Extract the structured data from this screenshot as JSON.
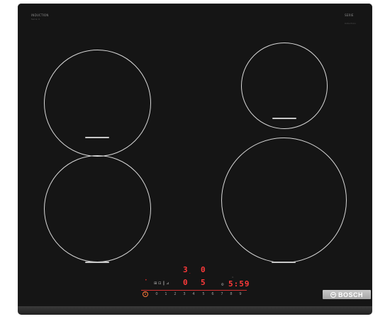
{
  "labels": {
    "top_left_title": "INDUCTION",
    "top_left_sub": "Serie 4",
    "top_right_title": "SERIE",
    "top_right_sub": "Induction",
    "brand": "BOSCH"
  },
  "display": {
    "timer": "5:59",
    "top_row": [
      "3",
      "0"
    ],
    "mid_row": [
      "0",
      "5"
    ]
  },
  "power_button": "1",
  "slider_levels": [
    "0",
    "1",
    "2",
    "3",
    "4",
    "5",
    "6",
    "7",
    "8",
    "9"
  ],
  "colors": {
    "glass": "#151515",
    "display_red": "#ff3a3a",
    "zone_outline": "#d8d8d8"
  }
}
